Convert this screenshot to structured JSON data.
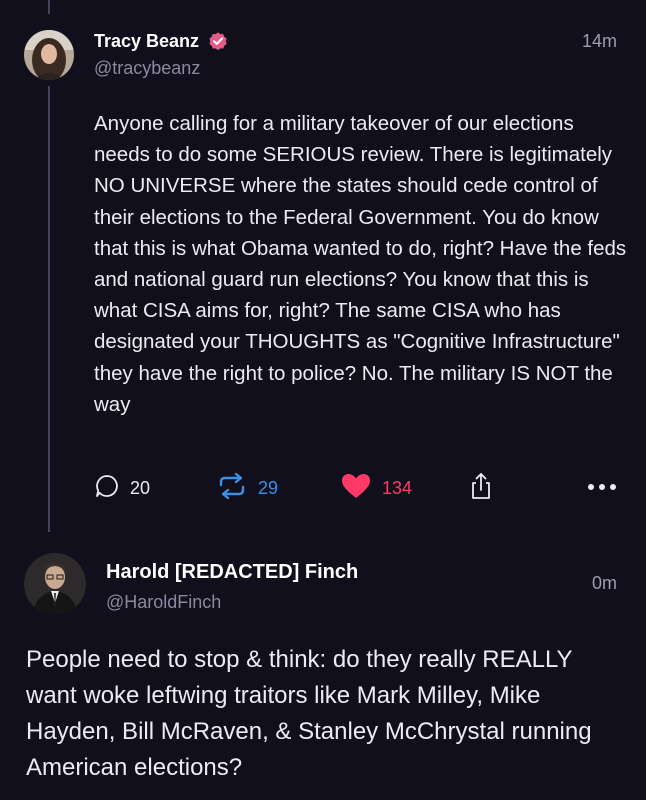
{
  "post1": {
    "author_name": "Tracy Beanz",
    "handle": "@tracybeanz",
    "time": "14m",
    "verified": true,
    "body": "Anyone calling for a military takeover of our elections needs to do some SERIOUS review. There is legitimately NO UNIVERSE where the states should cede control of their elections to the Federal Government. You do know that this is what Obama wanted to do, right? Have the feds and national guard run elections? You know that this is what CISA aims for, right? The same CISA who has designated your THOUGHTS as \"Cognitive Infrastructure\" they have the right to police? No. The military IS NOT the way",
    "actions": {
      "replies": "20",
      "reposts": "29",
      "likes": "134"
    }
  },
  "post2": {
    "author_name": "Harold [REDACTED] Finch",
    "handle": "@HaroldFinch",
    "time": "0m",
    "body": "People need to stop & think: do they really REALLY want woke leftwing traitors like Mark Milley, Mike Hayden, Bill McRaven, & Stanley McChrystal running American elections?"
  },
  "colors": {
    "background": "#120f1c",
    "verified_badge": "#e35b86",
    "repost_accent": "#3c8fe4",
    "like_accent": "#ff3a66"
  }
}
